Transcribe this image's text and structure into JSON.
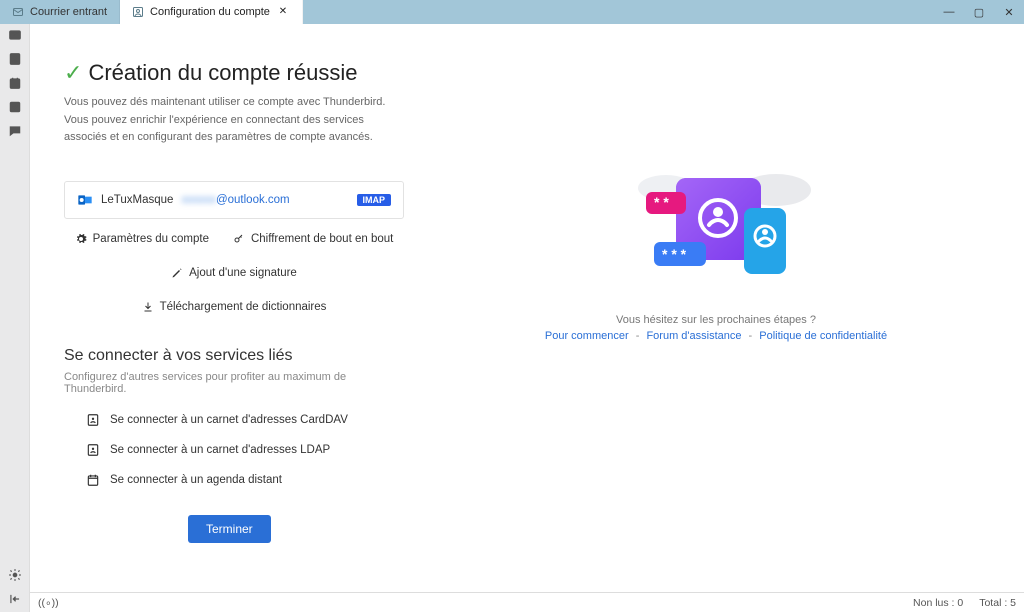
{
  "tabs": {
    "incoming": "Courrier entrant",
    "config": "Configuration du compte"
  },
  "heading": "Création du compte réussie",
  "sub1": "Vous pouvez dés maintenant utiliser ce compte avec Thunderbird.",
  "sub2": "Vous pouvez enrichir l'expérience en connectant des services associés et en configurant des paramètres de compte avancés.",
  "account": {
    "name": "LeTuxMasque",
    "email_user_hidden": "xxxxxx",
    "email_domain": "@outlook.com",
    "badge": "IMAP"
  },
  "actions": {
    "settings": "Paramètres du compte",
    "e2e": "Chiffrement de bout en bout",
    "sig": "Ajout d'une signature",
    "dict": "Téléchargement de dictionnaires"
  },
  "linked": {
    "title": "Se connecter à vos services liés",
    "sub": "Configurez d'autres services pour profiter au maximum de Thunderbird.",
    "carddav": "Se connecter à un carnet d'adresses CardDAV",
    "ldap": "Se connecter à un carnet d'adresses LDAP",
    "cal": "Se connecter à un agenda distant"
  },
  "finish": "Terminer",
  "help": {
    "q": "Vous hésitez sur les prochaines étapes ?",
    "start": "Pour commencer",
    "forum": "Forum d'assistance",
    "privacy": "Politique de confidentialité"
  },
  "status": {
    "unread_label": "Non lus :",
    "unread_value": "0",
    "total_label": "Total :",
    "total_value": "5"
  }
}
